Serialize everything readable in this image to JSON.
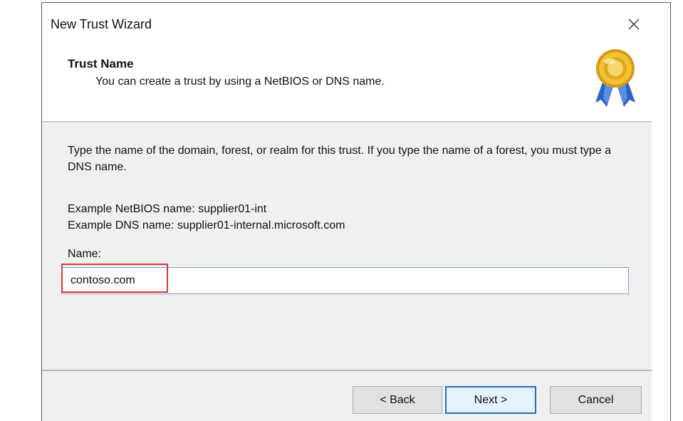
{
  "window": {
    "title": "New Trust Wizard",
    "close_icon": "close-icon"
  },
  "header": {
    "title": "Trust Name",
    "subtitle": "You can create a trust by using a NetBIOS or DNS name.",
    "icon": "medal-icon"
  },
  "content": {
    "intro": "Type the name of the domain, forest, or realm for this trust. If you type the name of a forest, you must type a DNS name.",
    "example_netbios": "Example NetBIOS name: supplier01-int",
    "example_dns": "Example DNS name: supplier01-internal.microsoft.com",
    "name_label": "Name:",
    "name_value": "contoso.com",
    "highlight_color": "#d9373d"
  },
  "buttons": {
    "back": "< Back",
    "next": "Next >",
    "cancel": "Cancel"
  },
  "colors": {
    "content_bg": "#f0f0f0",
    "focus_border": "#1e6fcc",
    "input_border": "#7a9cd3"
  }
}
